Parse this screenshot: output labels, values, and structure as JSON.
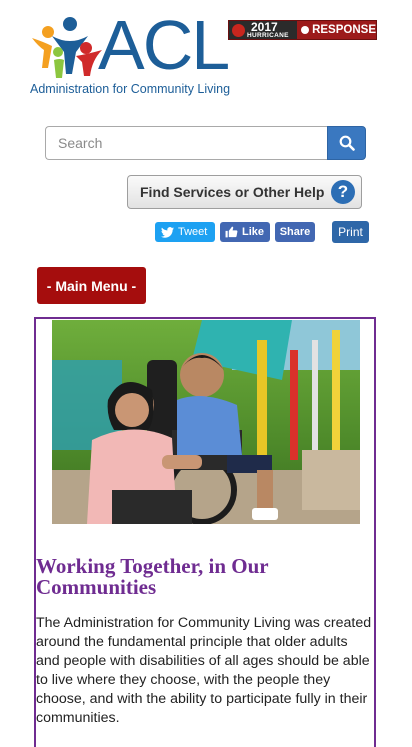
{
  "header": {
    "logo_text": "ACL",
    "logo_subtitle": "Administration for Community Living",
    "banner": {
      "year": "2017",
      "word": "HURRICANE",
      "label": "RESPONSE"
    }
  },
  "search": {
    "placeholder": "Search"
  },
  "find_services": {
    "label": "Find Services or Other Help",
    "help_glyph": "?"
  },
  "share": {
    "tweet": "Tweet",
    "like": "Like",
    "share": "Share",
    "print": "Print"
  },
  "menu": {
    "label": "- Main Menu -"
  },
  "feature": {
    "title": "Working Together, in Our Communities",
    "body": "The Administration for Community Living was created around the fundamental principle that older adults and people with disabilities of all ages should be able to live where they choose, with the people they choose, and with the ability to participate fully in their communities."
  },
  "colors": {
    "brand_blue": "#1d5e98",
    "menu_red": "#a50d0d",
    "feature_purple": "#6f2c91",
    "search_blue": "#3a78c0"
  }
}
